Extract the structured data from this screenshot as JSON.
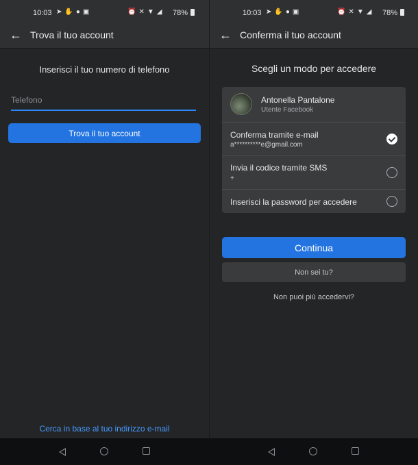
{
  "status": {
    "time": "10:03",
    "battery": "78%"
  },
  "left": {
    "title": "Trova il tuo account",
    "heading": "Inserisci il tuo numero di telefono",
    "phone_placeholder": "Telefono",
    "phone_value": "",
    "find_button": "Trova il tuo account",
    "email_link": "Cerca in base al tuo indirizzo e-mail"
  },
  "right": {
    "title": "Conferma il tuo account",
    "heading": "Scegli un modo per accedere",
    "user": {
      "name": "Antonella Pantalone",
      "subtitle": "Utente Facebook"
    },
    "options": [
      {
        "label": "Conferma tramite e-mail",
        "sub": "a**********e@gmail.com",
        "selected": true
      },
      {
        "label": "Invia il codice tramite SMS",
        "sub": "+",
        "selected": false
      },
      {
        "label": "Inserisci la password per accedere",
        "sub": "",
        "selected": false
      }
    ],
    "continue_button": "Continua",
    "not_you_button": "Non sei tu?",
    "no_access_link": "Non puoi più accedervi?"
  },
  "colors": {
    "accent": "#2374e1",
    "link": "#4599ff",
    "background": "#242526",
    "card": "#3a3b3c"
  },
  "icons": [
    "arrow-left-icon",
    "telegram-icon",
    "messenger-icon",
    "alarm-icon",
    "wifi-icon",
    "signal-icon",
    "battery-icon",
    "nav-back-icon",
    "nav-home-icon",
    "nav-recent-icon",
    "check-icon"
  ]
}
